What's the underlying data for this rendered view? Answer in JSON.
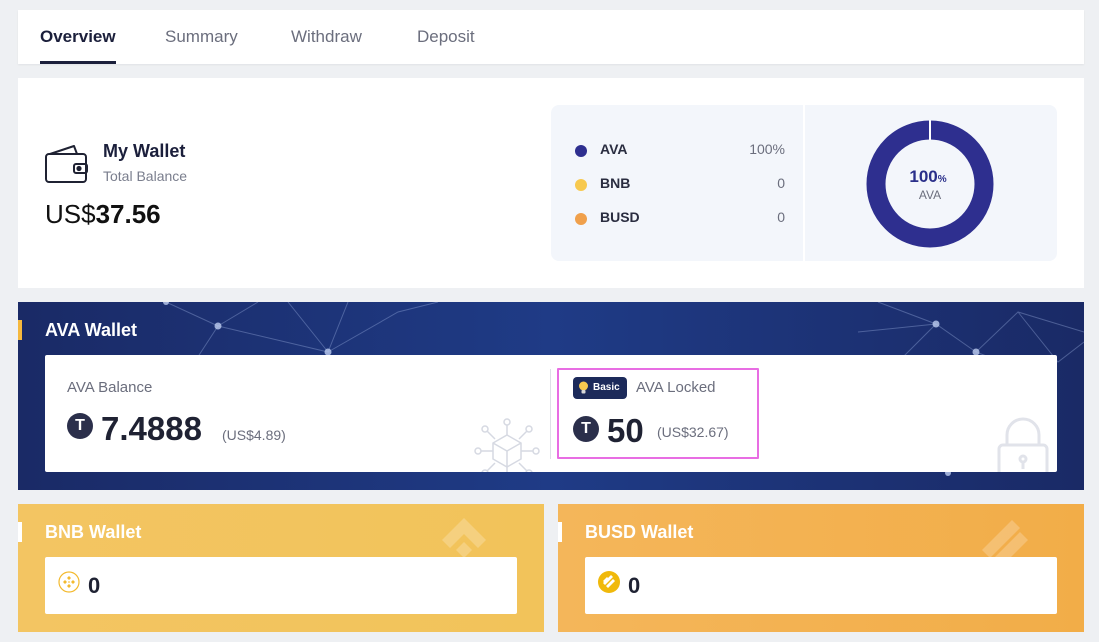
{
  "tabs": [
    {
      "label": "Overview",
      "active": true
    },
    {
      "label": "Summary",
      "active": false
    },
    {
      "label": "Withdraw",
      "active": false
    },
    {
      "label": "Deposit",
      "active": false
    }
  ],
  "my_wallet": {
    "title": "My Wallet",
    "subtitle": "Total Balance",
    "currency_prefix": "US$",
    "amount": "37.56"
  },
  "allocation": {
    "items": [
      {
        "name": "AVA",
        "value": "100%",
        "color": "#2e2f8f"
      },
      {
        "name": "BNB",
        "value": "0",
        "color": "#f7c94f"
      },
      {
        "name": "BUSD",
        "value": "0",
        "color": "#f0a04b"
      }
    ],
    "donut": {
      "center_value": "100",
      "center_unit": "%",
      "center_label": "AVA",
      "fraction": 1.0,
      "color": "#2e2f8f"
    }
  },
  "ava_wallet": {
    "title": "AVA Wallet",
    "balance_label": "AVA Balance",
    "balance_value": "7.4888",
    "balance_usd": "(US$4.89)",
    "badge_label": "Basic",
    "locked_label": "AVA Locked",
    "locked_value": "50",
    "locked_usd": "(US$32.67)",
    "coin_glyph": "T",
    "accent_color": "#f5b83d"
  },
  "bnb_wallet": {
    "title": "BNB Wallet",
    "value": "0",
    "icon": "bnb-coin-icon"
  },
  "busd_wallet": {
    "title": "BUSD Wallet",
    "value": "0",
    "icon": "busd-coin-icon"
  }
}
